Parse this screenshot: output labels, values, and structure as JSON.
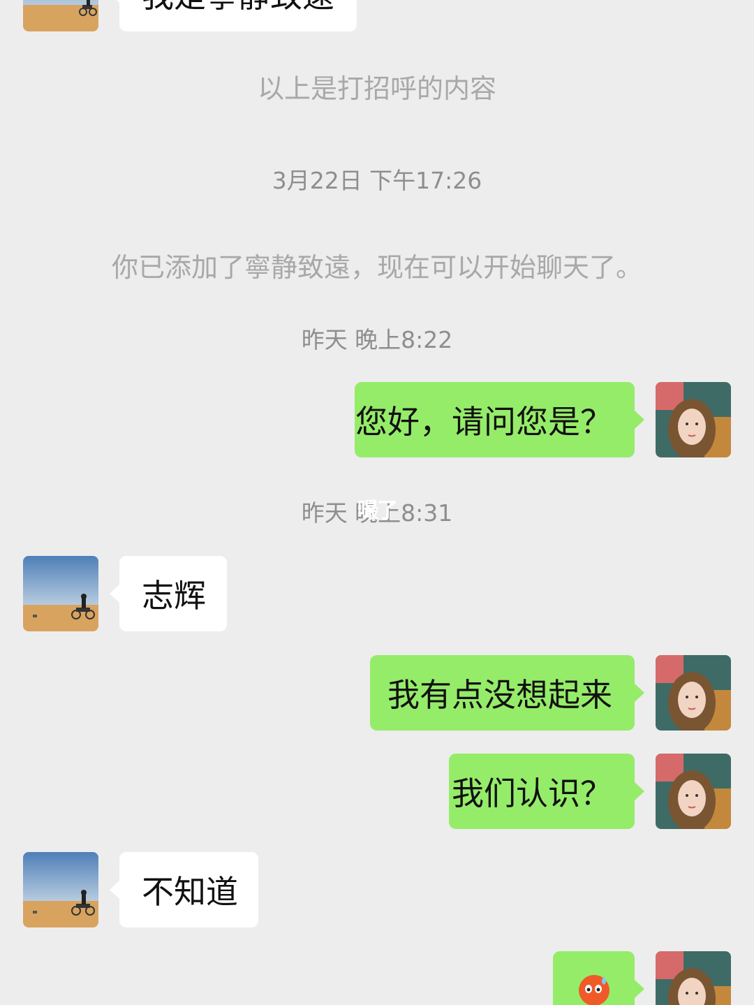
{
  "messages": {
    "m0_partial": "我是寧靜致遠",
    "greeting_note": "以上是打招呼的内容",
    "t1": "3月22日 下午17:26",
    "added_note": "你已添加了寧静致遠，现在可以开始聊天了。",
    "t2": "昨天 晚上8:22",
    "out1": "您好，请问您是？",
    "t3": "昨天 晚上8:31",
    "in1": "志辉",
    "out2": "我有点没想起来",
    "out3": "我们认识？",
    "in2": "不知道",
    "out4_icon": "sweat-face-emoji"
  },
  "watermark": "嘬了",
  "colors": {
    "background": "#ededed",
    "outgoing_bubble": "#95ec69",
    "incoming_bubble": "#ffffff",
    "system_text": "#9a9a9a"
  }
}
